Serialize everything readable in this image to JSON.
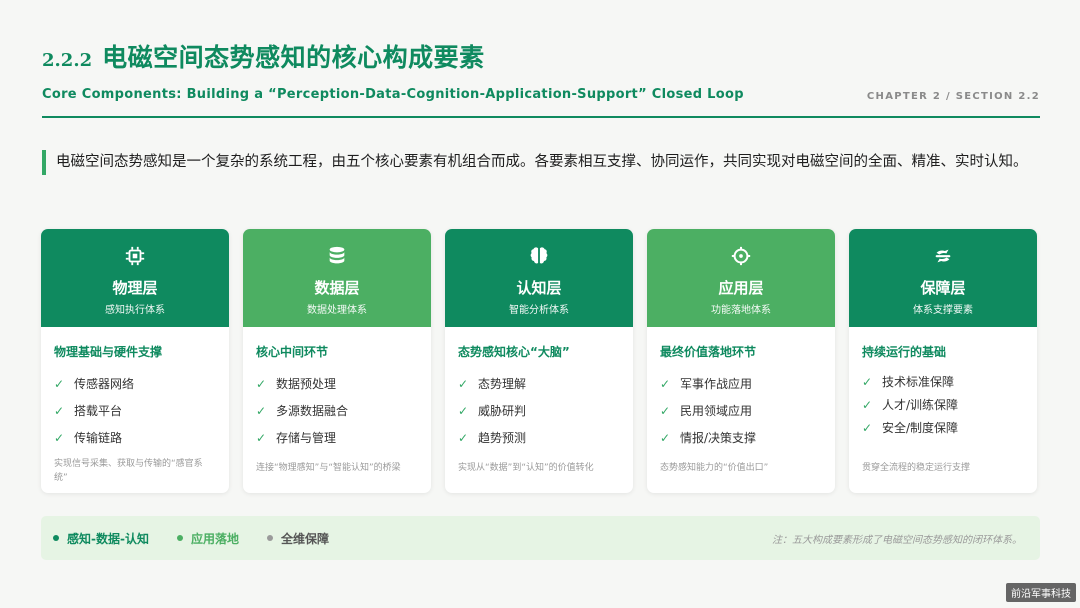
{
  "header": {
    "section_number": "2.2.2",
    "title": "电磁空间态势感知的核心构成要素",
    "subtitle": "Core Components: Building a “Perception-Data-Cognition-Application-Support” Closed Loop",
    "chapter_label": "CHAPTER 2 / SECTION 2.2"
  },
  "intro": "电磁空间态势感知是一个复杂的系统工程，由五个核心要素有机组合而成。各要素相互支撑、协同运作，共同实现对电磁空间的全面、精准、实时认知。",
  "colors": {
    "primary": "#0f8a5f",
    "secondary": "#4caf63",
    "gray": "#9a9a9a"
  },
  "cards": [
    {
      "icon": "cpu-chip-icon",
      "name": "物理层",
      "subtitle": "感知执行体系",
      "body_title": "物理基础与硬件支撑",
      "items": [
        "传感器网络",
        "搭载平台",
        "传输链路"
      ],
      "note": "实现信号采集、获取与传输的“感官系统”"
    },
    {
      "icon": "database-icon",
      "name": "数据层",
      "subtitle": "数据处理体系",
      "body_title": "核心中间环节",
      "items": [
        "数据预处理",
        "多源数据融合",
        "存储与管理"
      ],
      "note": "连接“物理感知”与“智能认知”的桥梁"
    },
    {
      "icon": "brain-icon",
      "name": "认知层",
      "subtitle": "智能分析体系",
      "body_title": "态势感知核心“大脑”",
      "items": [
        "态势理解",
        "威胁研判",
        "趋势预测"
      ],
      "note": "实现从“数据”到“认知”的价值转化"
    },
    {
      "icon": "crosshair-icon",
      "name": "应用层",
      "subtitle": "功能落地体系",
      "body_title": "最终价值落地环节",
      "items": [
        "军事作战应用",
        "民用领域应用",
        "情报/决策支撑"
      ],
      "note": "态势感知能力的“价值出口”"
    },
    {
      "icon": "handshake-icon",
      "name": "保障层",
      "subtitle": "体系支撑要素",
      "body_title": "持续运行的基础",
      "items": [
        "技术标准保障",
        "人才/训练保障",
        "安全/制度保障"
      ],
      "note": "贯穿全流程的稳定运行支撑"
    }
  ],
  "footer": {
    "tags": [
      {
        "label": "感知-数据-认知",
        "color": "#0f8a5f"
      },
      {
        "label": "应用落地",
        "color": "#4caf63"
      },
      {
        "label": "全维保障",
        "color": "#9a9a9a"
      }
    ],
    "note": "注：五大构成要素形成了电磁空间态势感知的闭环体系。"
  },
  "watermark": "前沿军事科技"
}
